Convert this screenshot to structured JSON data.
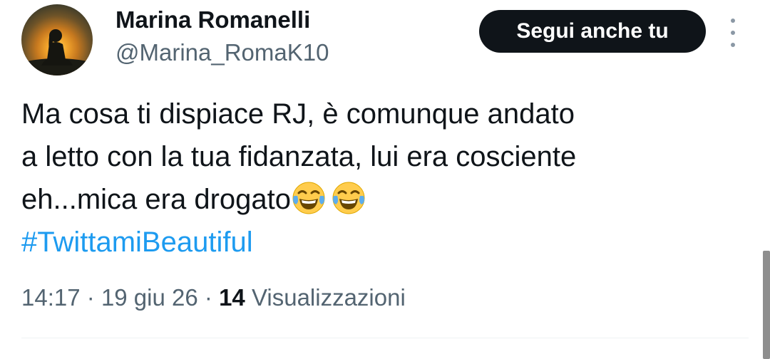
{
  "user": {
    "display_name": "Marina Romanelli",
    "handle": "@Marina_RomaK10",
    "avatar_icon": "silhouette-sunset-avatar"
  },
  "follow_button": {
    "label": "Segui anche tu"
  },
  "more_button": {
    "icon": "more-vertical-icon"
  },
  "tweet": {
    "lines": [
      "Ma cosa ti dispiace RJ, è comunque andato",
      "a letto con la tua fidanzata, lui era cosciente",
      "eh...mica era drogato"
    ],
    "emojis": [
      "face-with-tears-of-joy",
      "face-with-tears-of-joy"
    ],
    "hashtag": "#TwittamiBeautiful"
  },
  "meta": {
    "time": "14:17",
    "separator": "·",
    "date": "19 giu 26",
    "views_count": "14",
    "views_label": "Visualizzazioni"
  },
  "colors": {
    "text": "#0f1419",
    "secondary": "#536471",
    "link": "#1d9bf0",
    "button_bg": "#0f1419"
  }
}
